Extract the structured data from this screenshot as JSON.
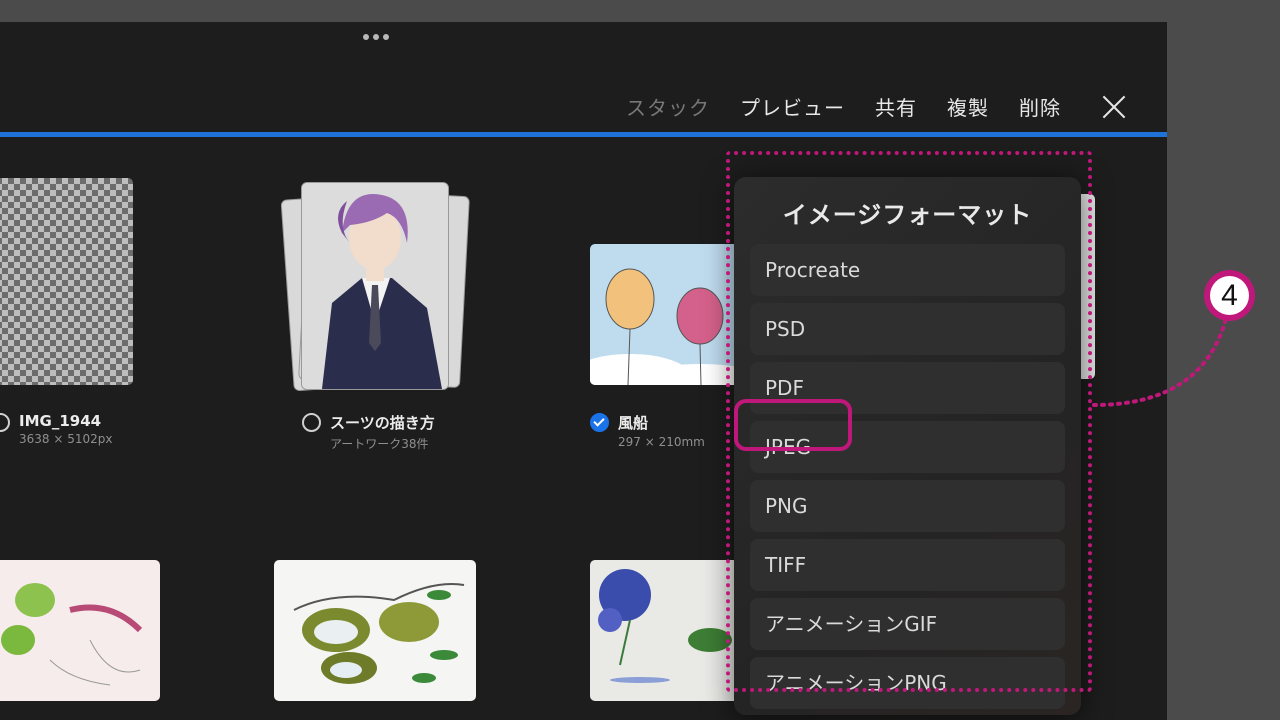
{
  "toolbar": {
    "stack": "スタック",
    "preview": "プレビュー",
    "share": "共有",
    "duplicate": "複製",
    "delete": "削除"
  },
  "gallery": {
    "items": [
      {
        "title": "IMG_1944",
        "sub": "3638 × 5102px",
        "selected": false
      },
      {
        "title": "スーツの描き方",
        "sub": "アートワーク38件",
        "selected": false
      },
      {
        "title": "風船",
        "sub": "297 × 210mm",
        "selected": true
      }
    ]
  },
  "menu": {
    "title": "イメージフォーマット",
    "items": [
      "Procreate",
      "PSD",
      "PDF",
      "JPEG",
      "PNG",
      "TIFF",
      "アニメーションGIF",
      "アニメーションPNG"
    ]
  },
  "annotation": {
    "step": "4",
    "color": "#c0187a"
  },
  "colors": {
    "accent": "#1f72d8",
    "background": "#1d1d1d"
  }
}
